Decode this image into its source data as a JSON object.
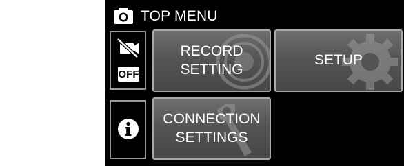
{
  "header": {
    "title": "TOP MENU",
    "icon": "camera-icon"
  },
  "side": {
    "top_icon": "camera-off-icon",
    "off_badge": "OFF",
    "bottom_icon": "info-icon"
  },
  "tiles": [
    {
      "label": "RECORD\nSETTING",
      "icon": "record-dial-icon"
    },
    {
      "label": "SETUP",
      "icon": "gear-icon"
    },
    {
      "label": "CONNECTION\nSETTINGS",
      "icon": "wrench-icon"
    }
  ],
  "colors": {
    "screen_bg": "#000000",
    "tile_border": "#a8a8a8",
    "tile_fill": "#555555",
    "text": "#ffffff"
  }
}
